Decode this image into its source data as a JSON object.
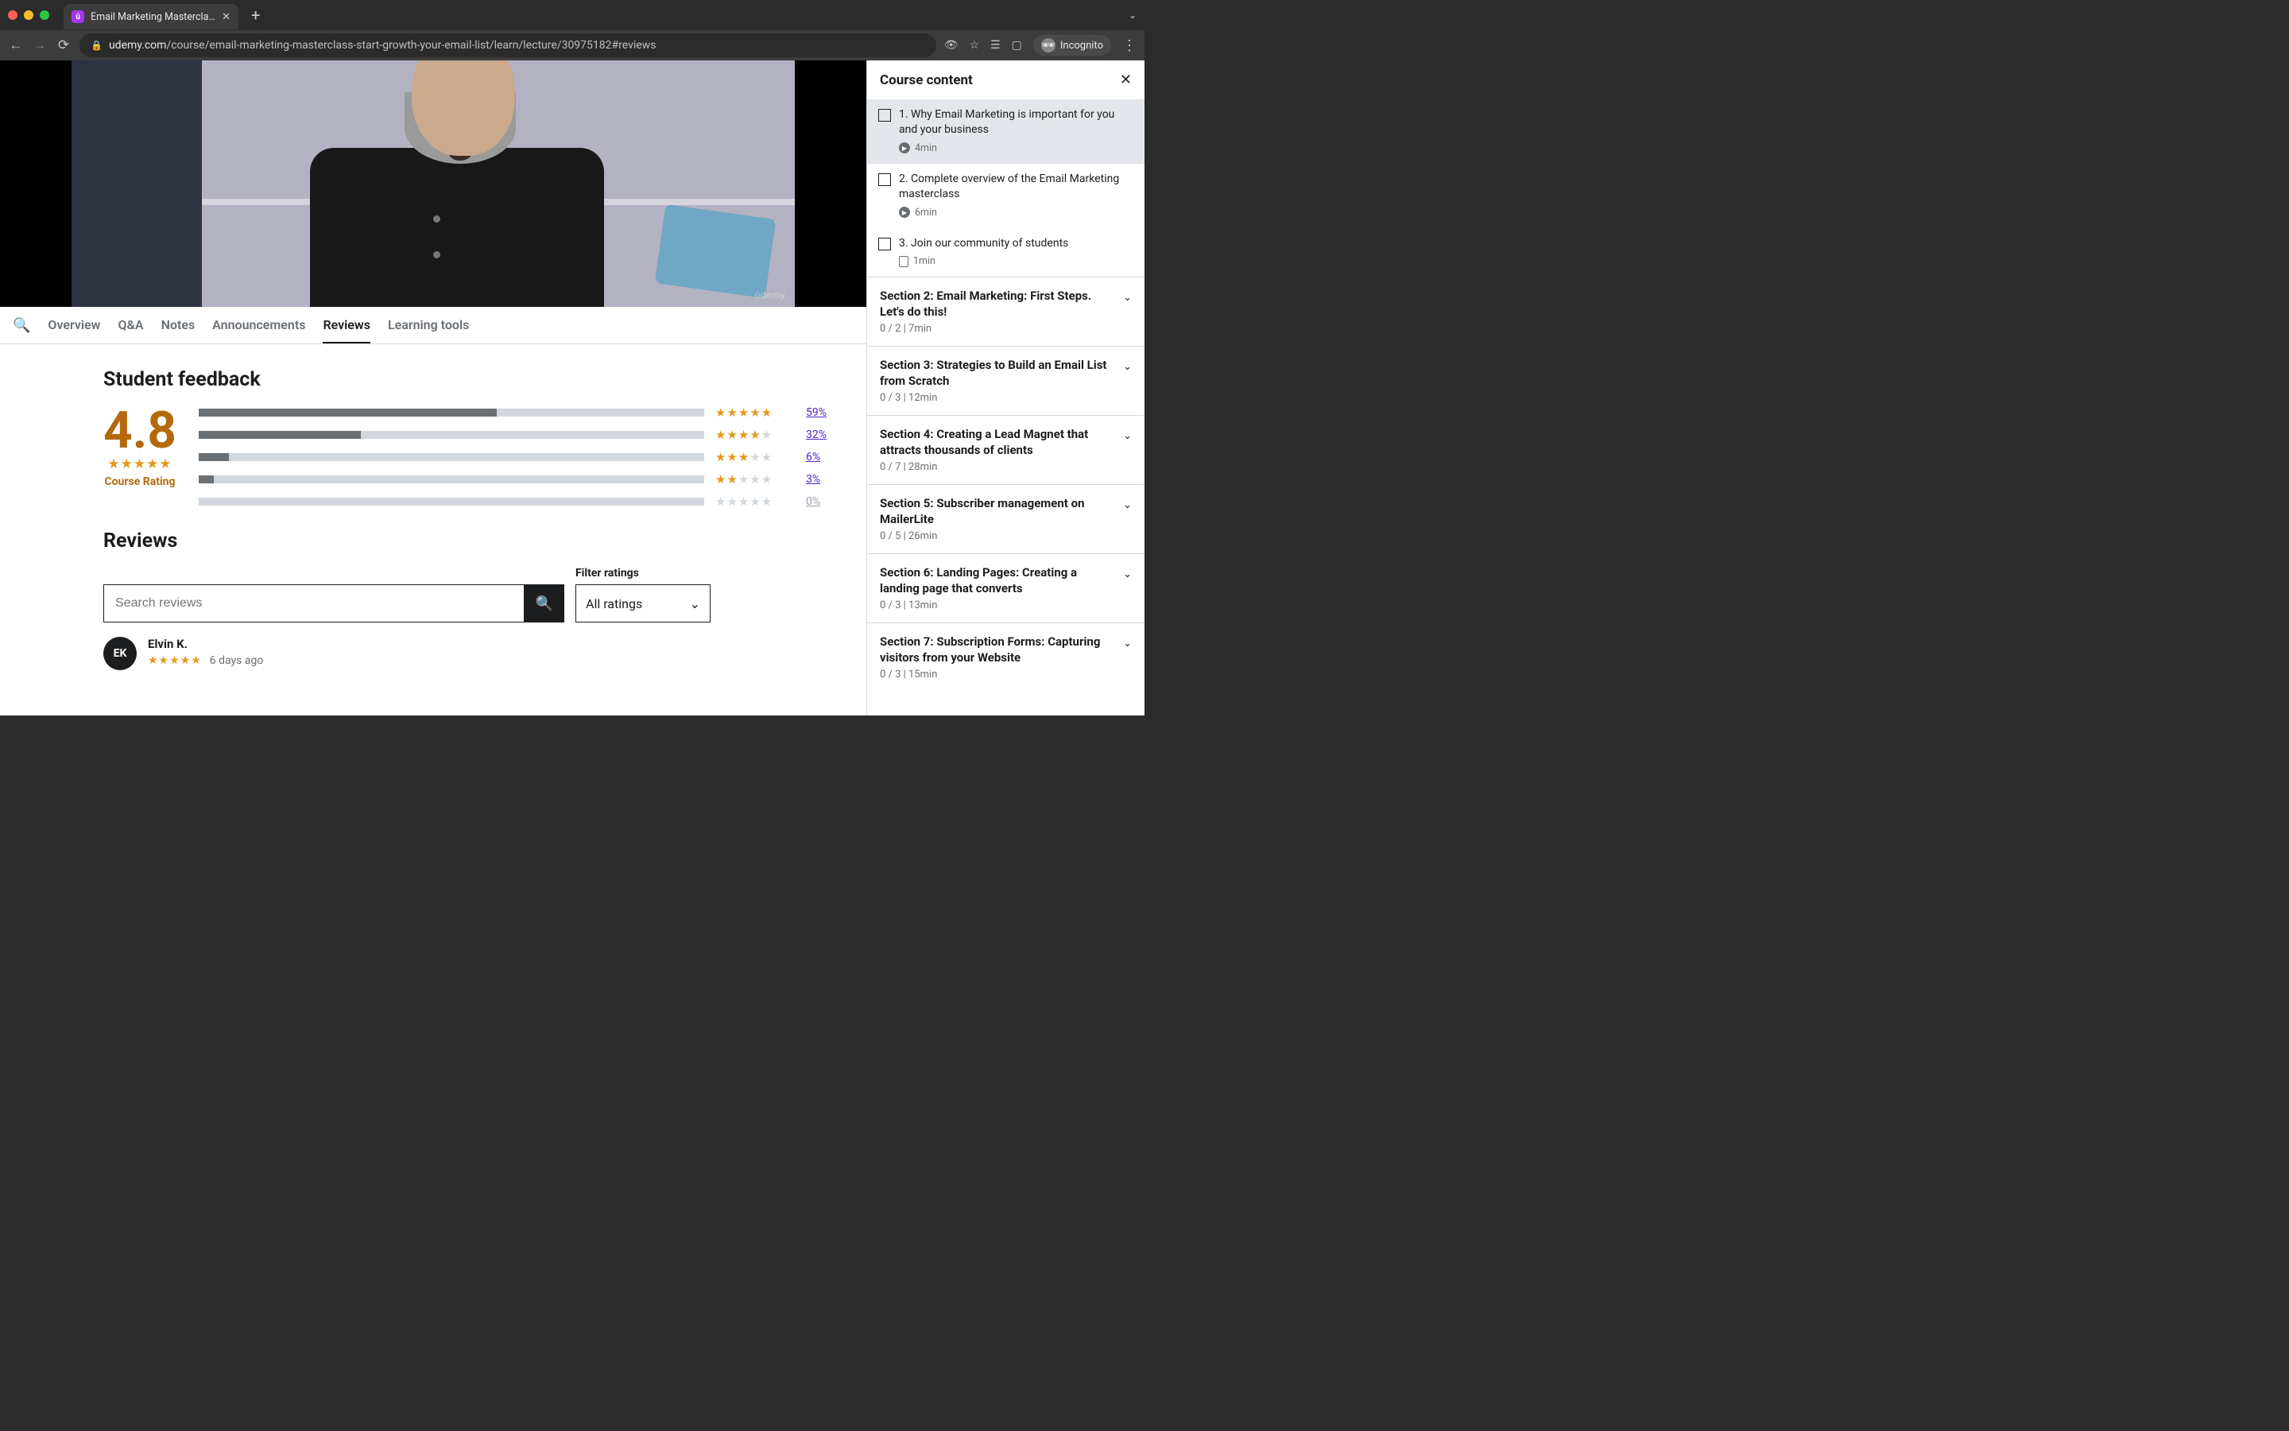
{
  "browser": {
    "tab_title": "Email Marketing Masterclass:",
    "url_host": "udemy.com",
    "url_path": "/course/email-marketing-masterclass-start-growth-your-email-list/learn/lecture/30975182#reviews",
    "incognito_label": "Incognito"
  },
  "video_watermark": "ûdemy",
  "tabs": {
    "overview": "Overview",
    "qa": "Q&A",
    "notes": "Notes",
    "announcements": "Announcements",
    "reviews": "Reviews",
    "learning_tools": "Learning tools"
  },
  "feedback": {
    "heading": "Student feedback",
    "rating_value": "4.8",
    "rating_label": "Course Rating",
    "bars": [
      {
        "stars": 5,
        "pct": "59%",
        "fill": 59
      },
      {
        "stars": 4,
        "pct": "32%",
        "fill": 32
      },
      {
        "stars": 3,
        "pct": "6%",
        "fill": 6
      },
      {
        "stars": 2,
        "pct": "3%",
        "fill": 3
      },
      {
        "stars": 1,
        "pct": "0%",
        "fill": 0
      }
    ]
  },
  "reviews": {
    "heading": "Reviews",
    "search_placeholder": "Search reviews",
    "filter_label": "Filter ratings",
    "filter_value": "All ratings",
    "items": [
      {
        "initials": "EK",
        "name": "Elvin K.",
        "date": "6 days ago",
        "stars": 5
      }
    ]
  },
  "sidebar": {
    "title": "Course content",
    "lessons": [
      {
        "title": "1. Why Email Marketing is important for you and your business",
        "duration": "4min",
        "type": "video",
        "active": true
      },
      {
        "title": "2. Complete overview of the Email Marketing masterclass",
        "duration": "6min",
        "type": "video",
        "active": false
      },
      {
        "title": "3. Join our community of students",
        "duration": "1min",
        "type": "doc",
        "active": false
      }
    ],
    "sections": [
      {
        "title": "Section 2: Email Marketing: First Steps. Let's do this!",
        "meta": "0 / 2 | 7min"
      },
      {
        "title": "Section 3: Strategies to Build an Email List from Scratch",
        "meta": "0 / 3 | 12min"
      },
      {
        "title": "Section 4: Creating a Lead Magnet that attracts thousands of clients",
        "meta": "0 / 7 | 28min"
      },
      {
        "title": "Section 5: Subscriber management on MailerLite",
        "meta": "0 / 5 | 26min"
      },
      {
        "title": "Section 6: Landing Pages: Creating a landing page that converts",
        "meta": "0 / 3 | 13min"
      },
      {
        "title": "Section 7: Subscription Forms: Capturing visitors from your Website",
        "meta": "0 / 3 | 15min"
      }
    ]
  }
}
